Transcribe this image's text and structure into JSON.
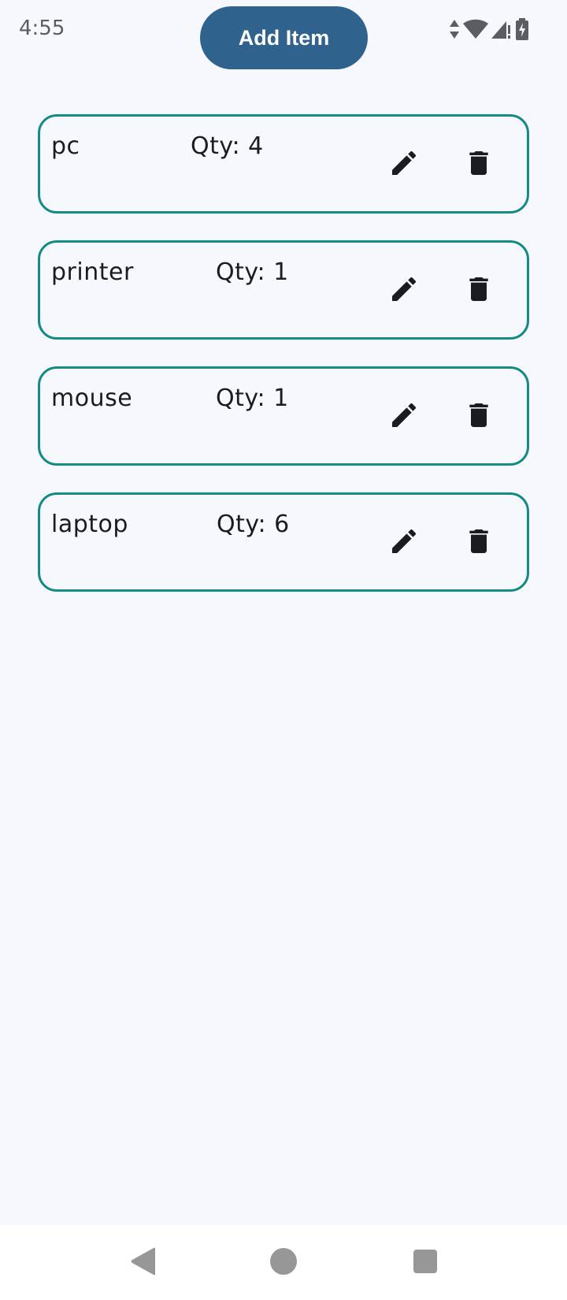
{
  "status_bar": {
    "time": "4:55",
    "icons": [
      "data-transfer-icon",
      "wifi-icon",
      "signal-icon",
      "battery-charging-icon"
    ]
  },
  "toolbar": {
    "add_label": "Add Item"
  },
  "items": [
    {
      "name": "pc",
      "qty": "Qty: 4"
    },
    {
      "name": "printer",
      "qty": "Qty: 1"
    },
    {
      "name": "mouse",
      "qty": "Qty: 1"
    },
    {
      "name": "laptop",
      "qty": "Qty: 6"
    }
  ],
  "item_actions": {
    "edit_icon": "pencil-icon",
    "delete_icon": "trash-icon"
  },
  "nav_bar": {
    "buttons": [
      "back-icon",
      "home-icon",
      "recents-icon"
    ]
  },
  "colors": {
    "background": "#f7f8fe",
    "accent": "#30628e",
    "card_border": "#168a86",
    "text": "#1b1c20"
  }
}
